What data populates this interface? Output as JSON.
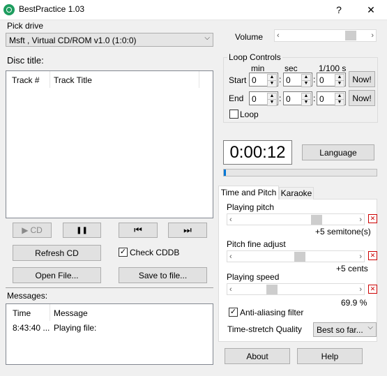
{
  "window": {
    "title": "BestPractice 1.03",
    "help": "?",
    "close": "✕"
  },
  "drive": {
    "label": "Pick drive",
    "value": "Msft     , Virtual CD/ROM   v1.0  (1:0:0)"
  },
  "disc": {
    "title_label": "Disc title:",
    "col_track_num": "Track #",
    "col_track_title": "Track Title"
  },
  "transport": {
    "play_label": "CD",
    "play_icon": "▶",
    "pause_icon": "❚❚",
    "prev_icon": "⏮",
    "next_icon": "⏭"
  },
  "buttons": {
    "refresh_cd": "Refresh CD",
    "check_cddb": "Check CDDB",
    "open_file": "Open File...",
    "save_to_file": "Save to file...",
    "language": "Language",
    "about": "About",
    "help": "Help"
  },
  "messages": {
    "label": "Messages:",
    "col_time": "Time",
    "col_message": "Message",
    "rows": [
      {
        "time": "8:43:40 ...",
        "message": "Playing file:"
      }
    ]
  },
  "volume": {
    "label": "Volume",
    "level": 0.88
  },
  "loop": {
    "title": "Loop Controls",
    "min_label": "min",
    "sec_label": "sec",
    "cs_label": "1/100 s",
    "start_label": "Start",
    "end_label": "End",
    "start": {
      "min": "0",
      "sec": "0",
      "cs": "0"
    },
    "end": {
      "min": "0",
      "sec": "0",
      "cs": "0"
    },
    "now_label": "Now!",
    "loop_checkbox": "Loop",
    "colon": ":"
  },
  "time_display": "0:00:12",
  "progress": 0.01,
  "tabs": {
    "active": "Time and Pitch",
    "other": "Karaoke"
  },
  "pitch": {
    "label": "Playing pitch",
    "value": "+5 semitone(s)"
  },
  "fine": {
    "label": "Pitch fine adjust",
    "value": "+5 cents"
  },
  "speed": {
    "label": "Playing speed",
    "value": "69.9 %"
  },
  "antialias": {
    "label": "Anti-aliasing filter",
    "checked": true
  },
  "quality": {
    "label": "Time-stretch Quality",
    "value": "Best so far..."
  },
  "colors": {
    "accent": "#0078d7",
    "delete": "#cc0000",
    "app_icon": "#1e9d5f"
  }
}
